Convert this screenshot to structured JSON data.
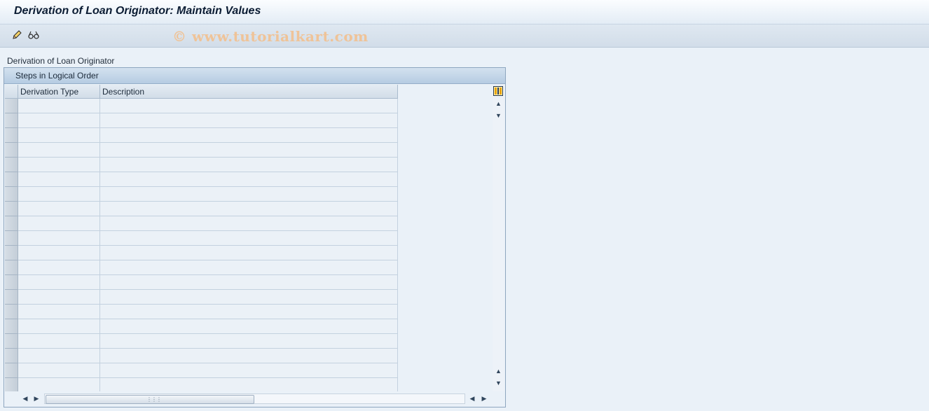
{
  "window": {
    "title": "Derivation of Loan Originator: Maintain Values"
  },
  "toolbar": {
    "buttons": [
      {
        "icon": "pencil-icon",
        "tooltip": "Display/Change"
      },
      {
        "icon": "glasses-icon",
        "tooltip": "Display"
      }
    ],
    "watermark": "© www.tutorialkart.com"
  },
  "main": {
    "section_label": "Derivation of Loan Originator",
    "table": {
      "title": "Steps in Logical Order",
      "columns": [
        "Derivation Type",
        "Description"
      ],
      "row_count": 20
    }
  },
  "colors": {
    "background": "#eaf1f8",
    "watermark": "#efc398",
    "table_title_bar": "#c2d5e8"
  }
}
